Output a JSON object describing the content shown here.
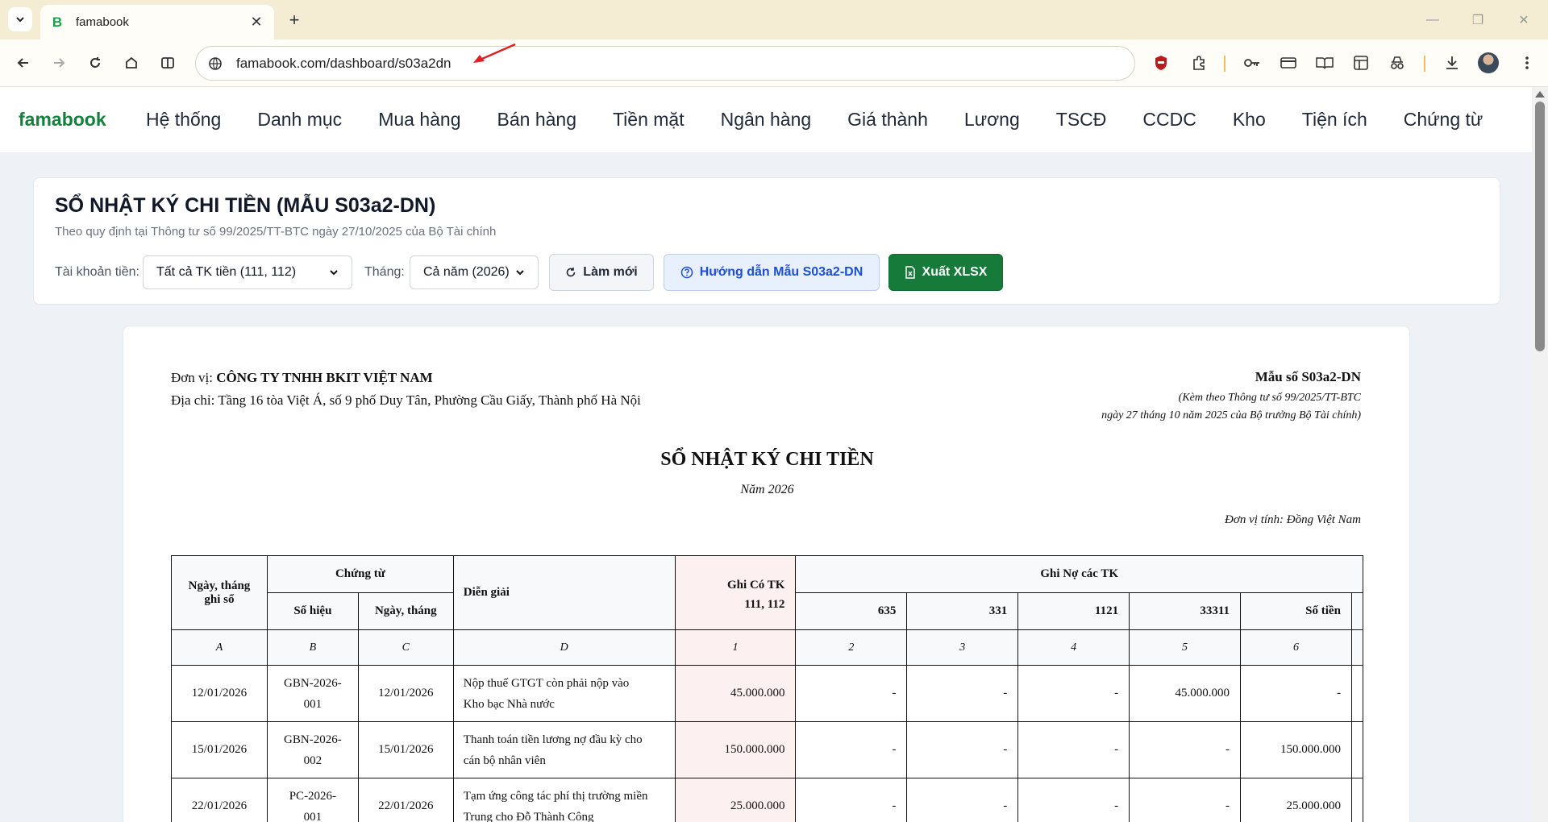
{
  "browser": {
    "tab_title": "famabook",
    "tab_favicon": "B",
    "url": "famabook.com/dashboard/s03a2dn"
  },
  "app": {
    "brand": "famabook",
    "nav": [
      "Hệ thống",
      "Danh mục",
      "Mua hàng",
      "Bán hàng",
      "Tiền mặt",
      "Ngân hàng",
      "Giá thành",
      "Lương",
      "TSCĐ",
      "CCDC",
      "Kho",
      "Tiện ích",
      "Chứng từ"
    ]
  },
  "filter": {
    "title": "SỔ NHẬT KÝ CHI TIỀN (MẪU S03a2-DN)",
    "subtitle": "Theo quy định tại Thông tư số 99/2025/TT-BTC ngày 27/10/2025 của Bộ Tài chính",
    "account_label": "Tài khoản tiền:",
    "account_value": "Tất cả TK tiền (111, 112)",
    "month_label": "Tháng:",
    "month_value": "Cả năm (2026)",
    "refresh_label": "Làm mới",
    "guide_label": "Hướng dẫn Mẫu S03a2-DN",
    "export_label": "Xuất XLSX"
  },
  "report": {
    "unit_label": "Đơn vị:",
    "unit_name": "CÔNG TY TNHH BKIT VIỆT NAM",
    "address_label": "Địa chỉ:",
    "address": "Tầng 16 tòa Việt Á, số 9 phố Duy Tân, Phường Cầu Giấy, Thành phố Hà Nội",
    "form_no": "Mẫu số S03a2-DN",
    "form_ref1": "(Kèm theo Thông tư số 99/2025/TT-BTC",
    "form_ref2": "ngày 27 tháng 10 năm 2025 của Bộ trưởng Bộ Tài chính)",
    "title": "SỔ NHẬT KÝ CHI TIỀN",
    "year": "Năm 2026",
    "currency": "Đơn vị tính: Đồng Việt Nam",
    "headers": {
      "date_line1": "Ngày, tháng",
      "date_line2": "ghi sổ",
      "voucher": "Chứng từ",
      "voucher_no": "Số hiệu",
      "voucher_date": "Ngày, tháng",
      "description": "Diễn giải",
      "credit_line1": "Ghi Có TK",
      "credit_line2": "111, 112",
      "debit_group": "Ghi Nợ các TK",
      "debit_cols": [
        "635",
        "331",
        "1121",
        "33311",
        "Số tiền"
      ]
    },
    "letters": [
      "A",
      "B",
      "C",
      "D",
      "1",
      "2",
      "3",
      "4",
      "5",
      "6"
    ],
    "rows": [
      {
        "date": "12/01/2026",
        "no_line1": "GBN-2026-",
        "no_line2": "001",
        "vdate": "12/01/2026",
        "desc_line1": "Nộp thuế GTGT còn phải nộp vào",
        "desc_line2": "Kho bạc Nhà nước",
        "credit": "45.000.000",
        "d635": "-",
        "d331": "-",
        "d1121": "-",
        "d33311": "45.000.000",
        "other": "-"
      },
      {
        "date": "15/01/2026",
        "no_line1": "GBN-2026-",
        "no_line2": "002",
        "vdate": "15/01/2026",
        "desc_line1": "Thanh toán tiền lương nợ đầu kỳ cho",
        "desc_line2": "cán bộ nhân viên",
        "credit": "150.000.000",
        "d635": "-",
        "d331": "-",
        "d1121": "-",
        "d33311": "-",
        "other": "150.000.000"
      },
      {
        "date": "22/01/2026",
        "no_line1": "PC-2026-",
        "no_line2": "001",
        "vdate": "22/01/2026",
        "desc_line1": "Tạm ứng công tác phí thị trường miền",
        "desc_line2": "Trung cho Đỗ Thành Công",
        "credit": "25.000.000",
        "d635": "-",
        "d331": "-",
        "d1121": "-",
        "d33311": "-",
        "other": "25.000.000"
      }
    ]
  }
}
